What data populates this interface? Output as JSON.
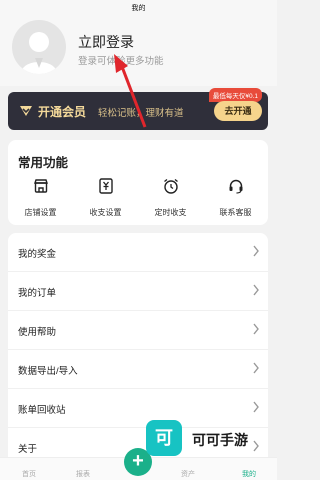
{
  "status_bar": {
    "title": "我的"
  },
  "profile": {
    "title": "立即登录",
    "subtitle": "登录可体验更多功能"
  },
  "vip": {
    "title": "开通会员",
    "description": "轻松记账，理财有道",
    "badge": "最低每天仅¥0.1",
    "button": "去开通",
    "colors": {
      "background": "#2f2f3a",
      "accent": "#f6d48c"
    }
  },
  "functions": {
    "title": "常用功能",
    "items": [
      {
        "label": "店铺设置",
        "icon": "store-icon"
      },
      {
        "label": "收支设置",
        "icon": "yuan-doc-icon"
      },
      {
        "label": "定时收支",
        "icon": "alarm-clock-icon"
      },
      {
        "label": "联系客服",
        "icon": "headset-icon"
      }
    ]
  },
  "menu": {
    "items": [
      {
        "label": "我的奖金"
      },
      {
        "label": "我的订单"
      },
      {
        "label": "使用帮助"
      },
      {
        "label": "数据导出/导入"
      },
      {
        "label": "账单回收站"
      },
      {
        "label": "关于"
      }
    ]
  },
  "tabbar": {
    "items": [
      {
        "label": "首页"
      },
      {
        "label": "报表"
      },
      {
        "label": ""
      },
      {
        "label": "资产"
      },
      {
        "label": "我的"
      }
    ],
    "add_label": "+",
    "accent": "#1bb08a"
  },
  "watermark": {
    "logo": "可",
    "text": "可可手游"
  }
}
